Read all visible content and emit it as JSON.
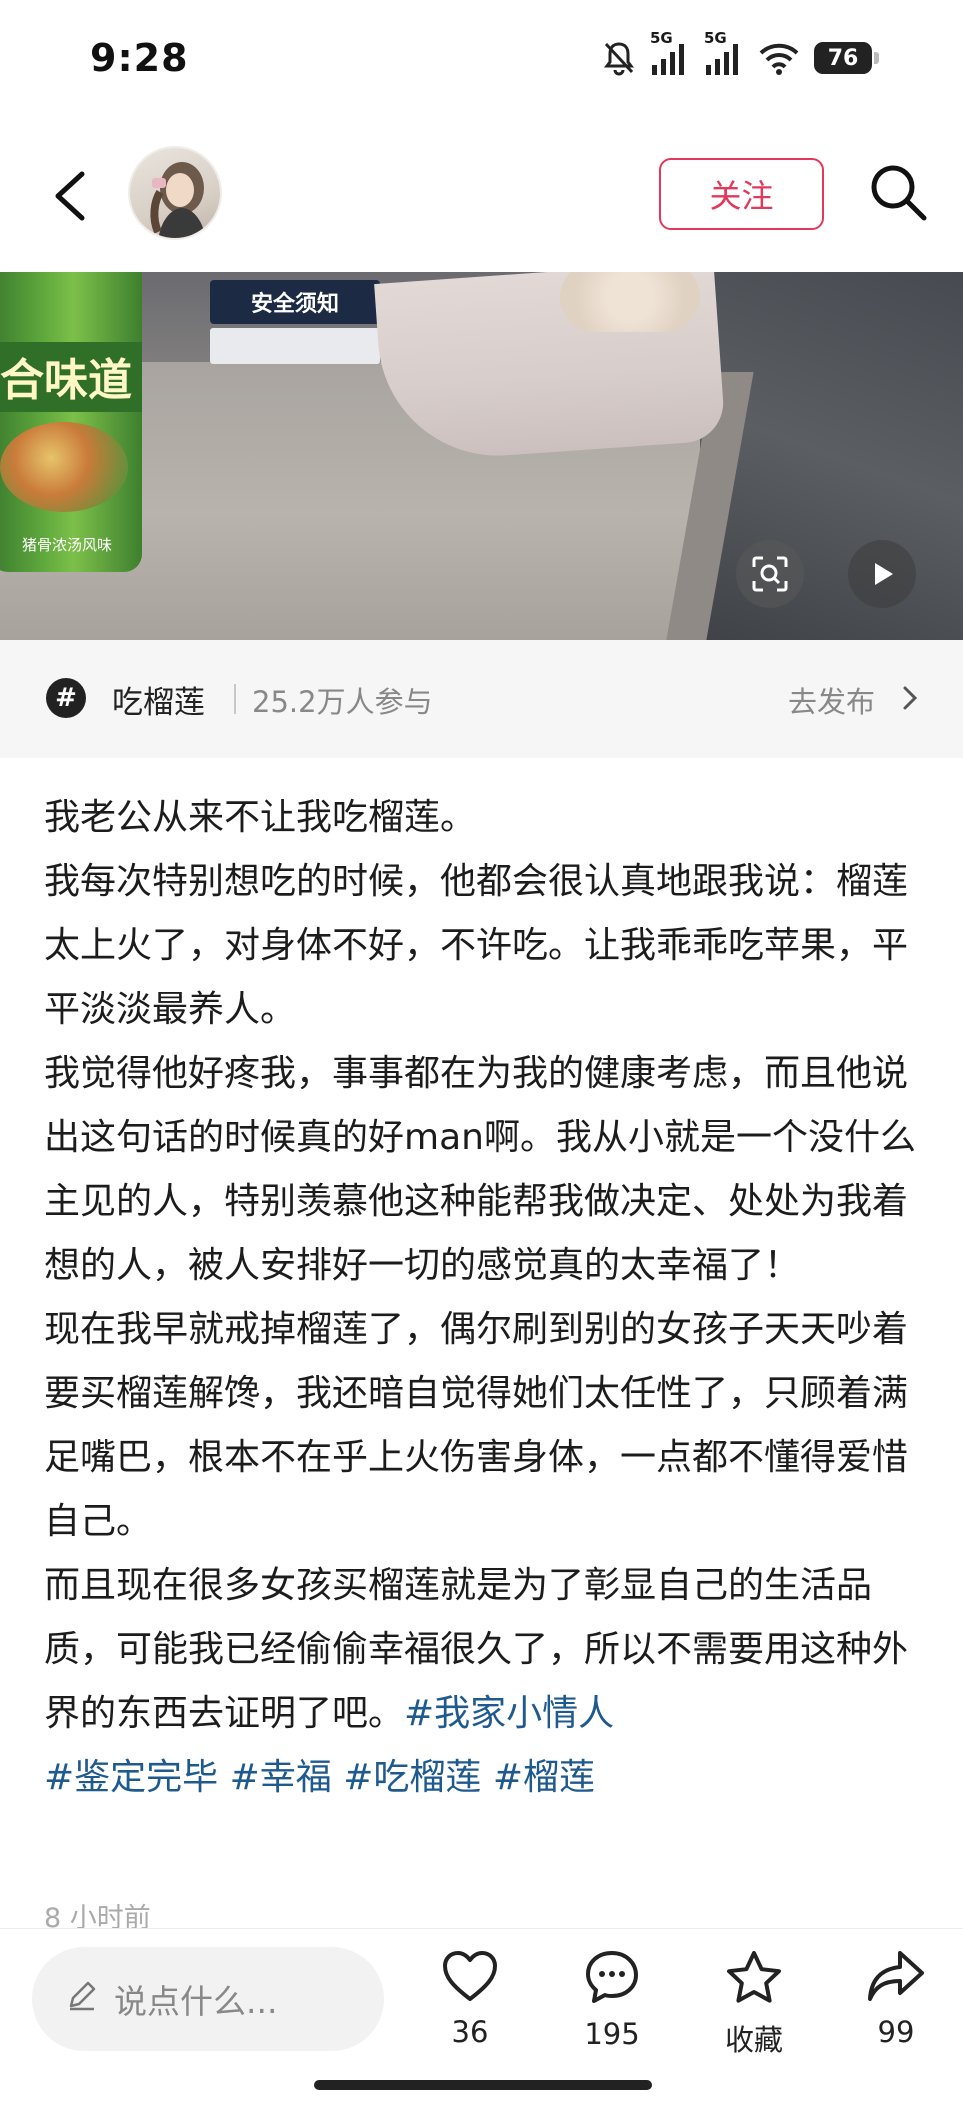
{
  "status_bar": {
    "time": "9:28",
    "signal_1": "5G",
    "signal_2": "5G",
    "battery": "76",
    "icons": [
      "mute-icon",
      "signal-icon",
      "signal-icon",
      "wifi-icon",
      "battery-icon"
    ]
  },
  "nav": {
    "follow_label": "关注",
    "icons": [
      "back-icon",
      "search-icon"
    ]
  },
  "photo": {
    "sign_text": "安全须知",
    "cup_text": "合味道",
    "cup_label": "猪骨浓汤风味",
    "icons": [
      "scan-icon",
      "play-icon"
    ]
  },
  "topic": {
    "name": "吃榴莲",
    "participants": "25.2万人参与",
    "publish_label": "去发布"
  },
  "post": {
    "paragraphs": [
      "我老公从来不让我吃榴莲。",
      "我每次特别想吃的时候，他都会很认真地跟我说：榴莲太上火了，对身体不好，不许吃。让我乖乖吃苹果，平平淡淡最养人。",
      "我觉得他好疼我，事事都在为我的健康考虑，而且他说出这句话的时候真的好man啊。我从小就是一个没什么主见的人，特别羡慕他这种能帮我做决定、处处为我着想的人，被人安排好一切的感觉真的太幸福了！",
      "现在我早就戒掉榴莲了，偶尔刷到别的女孩子天天吵着要买榴莲解馋，我还暗自觉得她们太任性了，只顾着满足嘴巴，根本不在乎上火伤害身体，一点都不懂得爱惜自己。",
      "而且现在很多女孩买榴莲就是为了彰显自己的生活品质，可能我已经偷偷幸福很久了，所以不需要用这种外界的东西去证明了吧。"
    ],
    "tags": [
      "#我家小情人",
      "#鉴定完毕",
      "#幸福",
      "#吃榴莲",
      "#榴莲"
    ],
    "timestamp": "8 小时前"
  },
  "bottom": {
    "comment_placeholder": "说点什么...",
    "likes": "36",
    "comments": "195",
    "collect_label": "收藏",
    "shares": "99"
  },
  "colors": {
    "follow_accent": "#e0395b",
    "tag_color": "#1f5a8e",
    "topic_bg": "#f6f6f6"
  }
}
